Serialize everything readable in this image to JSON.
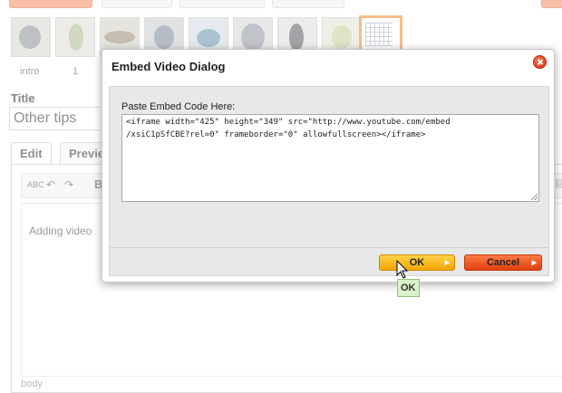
{
  "gallery": {
    "labels": [
      "intro",
      "1"
    ]
  },
  "form": {
    "title_label": "Title",
    "title_value": "Other tips",
    "tabs": [
      "Edit",
      "Previe"
    ],
    "editor_text": "Adding video",
    "status_path": "body"
  },
  "dialog": {
    "title": "Embed Video Dialog",
    "paste_label": "Paste Embed Code Here:",
    "embed_code": "<iframe width=\"425\" height=\"349\" src=\"http://www.youtube.com/embed\n/xsiC1pSfCBE?rel=0\" frameborder=\"0\" allowfullscreen></iframe>",
    "ok_label": "OK",
    "cancel_label": "Cancel",
    "tooltip": "OK"
  },
  "colors": {
    "ok": "#f3a500",
    "cancel": "#e0400f",
    "selected_thumb": "#f29a4a"
  },
  "icons": [
    "spellcheck-icon",
    "undo-icon",
    "redo-icon",
    "bold-icon",
    "close-icon",
    "mouse-pointer-icon"
  ]
}
